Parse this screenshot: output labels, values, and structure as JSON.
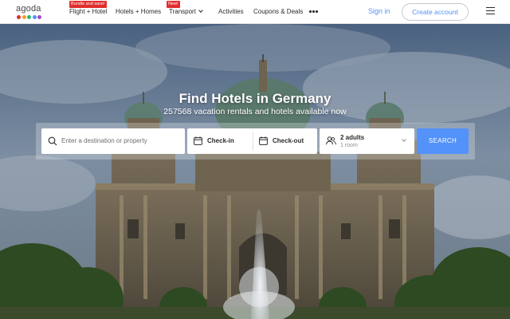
{
  "brand": {
    "logo_text": "agoda",
    "dot_colors": [
      "#e12d2d",
      "#f2a21f",
      "#2bb673",
      "#5392f9",
      "#a64ac9"
    ]
  },
  "nav": {
    "items": [
      {
        "label": "Flight + Hotel",
        "badge": "Bundle and save!",
        "has_dropdown": false
      },
      {
        "label": "Hotels + Homes",
        "badge": "",
        "has_dropdown": false
      },
      {
        "label": "Transport",
        "badge": "New!",
        "has_dropdown": true
      },
      {
        "label": "Activities",
        "badge": "",
        "has_dropdown": false
      },
      {
        "label": "Coupons & Deals",
        "badge": "",
        "has_dropdown": false
      }
    ],
    "more_icon": "more-horizontal-icon"
  },
  "account": {
    "signin_label": "Sign in",
    "create_label": "Create account",
    "menu_icon": "hamburger-menu-icon"
  },
  "hero": {
    "title": "Find Hotels in Germany",
    "subtitle": "257568 vacation rentals and hotels available now"
  },
  "search": {
    "destination_placeholder": "Enter a destination or property",
    "checkin_label": "Check-in",
    "checkout_label": "Check-out",
    "guests_main": "2 adults",
    "guests_sub": "1 room",
    "button_label": "SEARCH"
  },
  "colors": {
    "accent": "#5392f9",
    "badge": "#e12d2d"
  }
}
